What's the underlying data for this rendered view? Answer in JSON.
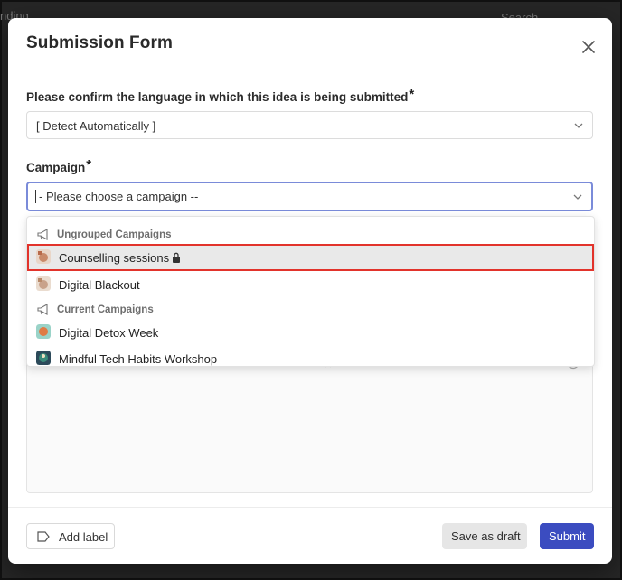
{
  "background": {
    "left_text": "nding",
    "right_text": "Search"
  },
  "modal": {
    "title": "Submission Form"
  },
  "language_field": {
    "label": "Please confirm the language in which this idea is being submitted",
    "required_mark": "*",
    "value": "[ Detect Automatically ]"
  },
  "campaign_field": {
    "label": "Campaign",
    "required_mark": "*",
    "placeholder": "- Please choose a campaign --"
  },
  "dropdown": {
    "groups": [
      {
        "header": "Ungrouped Campaigns",
        "options": [
          {
            "label": "Counselling sessions",
            "locked": true,
            "highlighted": true,
            "thumb_color": "#c98a6a"
          },
          {
            "label": "Digital Blackout",
            "locked": false,
            "highlighted": false,
            "thumb_color": "#c9a28a"
          }
        ]
      },
      {
        "header": "Current Campaigns",
        "options": [
          {
            "label": "Digital Detox Week",
            "locked": false,
            "highlighted": false,
            "thumb_color": "#e07b45"
          },
          {
            "label": "Mindful Tech Habits Workshop",
            "locked": false,
            "highlighted": false,
            "thumb_color": "#3a8a7a"
          }
        ]
      }
    ]
  },
  "footer": {
    "add_label": "Add label",
    "save_draft": "Save as draft",
    "submit": "Submit"
  },
  "colors": {
    "accent": "#3b4cc0",
    "highlight_outline": "#e2332b",
    "focus_border": "#7a8bd9"
  }
}
